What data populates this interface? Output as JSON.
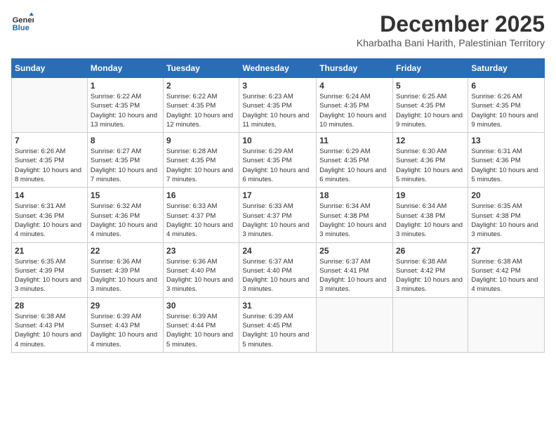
{
  "logo": {
    "line1": "General",
    "line2": "Blue"
  },
  "title": "December 2025",
  "location": "Kharbatha Bani Harith, Palestinian Territory",
  "columns": [
    "Sunday",
    "Monday",
    "Tuesday",
    "Wednesday",
    "Thursday",
    "Friday",
    "Saturday"
  ],
  "weeks": [
    [
      {
        "day": "",
        "sunrise": "",
        "sunset": "",
        "daylight": ""
      },
      {
        "day": "1",
        "sunrise": "Sunrise: 6:22 AM",
        "sunset": "Sunset: 4:35 PM",
        "daylight": "Daylight: 10 hours and 13 minutes."
      },
      {
        "day": "2",
        "sunrise": "Sunrise: 6:22 AM",
        "sunset": "Sunset: 4:35 PM",
        "daylight": "Daylight: 10 hours and 12 minutes."
      },
      {
        "day": "3",
        "sunrise": "Sunrise: 6:23 AM",
        "sunset": "Sunset: 4:35 PM",
        "daylight": "Daylight: 10 hours and 11 minutes."
      },
      {
        "day": "4",
        "sunrise": "Sunrise: 6:24 AM",
        "sunset": "Sunset: 4:35 PM",
        "daylight": "Daylight: 10 hours and 10 minutes."
      },
      {
        "day": "5",
        "sunrise": "Sunrise: 6:25 AM",
        "sunset": "Sunset: 4:35 PM",
        "daylight": "Daylight: 10 hours and 9 minutes."
      },
      {
        "day": "6",
        "sunrise": "Sunrise: 6:26 AM",
        "sunset": "Sunset: 4:35 PM",
        "daylight": "Daylight: 10 hours and 9 minutes."
      }
    ],
    [
      {
        "day": "7",
        "sunrise": "Sunrise: 6:26 AM",
        "sunset": "Sunset: 4:35 PM",
        "daylight": "Daylight: 10 hours and 8 minutes."
      },
      {
        "day": "8",
        "sunrise": "Sunrise: 6:27 AM",
        "sunset": "Sunset: 4:35 PM",
        "daylight": "Daylight: 10 hours and 7 minutes."
      },
      {
        "day": "9",
        "sunrise": "Sunrise: 6:28 AM",
        "sunset": "Sunset: 4:35 PM",
        "daylight": "Daylight: 10 hours and 7 minutes."
      },
      {
        "day": "10",
        "sunrise": "Sunrise: 6:29 AM",
        "sunset": "Sunset: 4:35 PM",
        "daylight": "Daylight: 10 hours and 6 minutes."
      },
      {
        "day": "11",
        "sunrise": "Sunrise: 6:29 AM",
        "sunset": "Sunset: 4:35 PM",
        "daylight": "Daylight: 10 hours and 6 minutes."
      },
      {
        "day": "12",
        "sunrise": "Sunrise: 6:30 AM",
        "sunset": "Sunset: 4:36 PM",
        "daylight": "Daylight: 10 hours and 5 minutes."
      },
      {
        "day": "13",
        "sunrise": "Sunrise: 6:31 AM",
        "sunset": "Sunset: 4:36 PM",
        "daylight": "Daylight: 10 hours and 5 minutes."
      }
    ],
    [
      {
        "day": "14",
        "sunrise": "Sunrise: 6:31 AM",
        "sunset": "Sunset: 4:36 PM",
        "daylight": "Daylight: 10 hours and 4 minutes."
      },
      {
        "day": "15",
        "sunrise": "Sunrise: 6:32 AM",
        "sunset": "Sunset: 4:36 PM",
        "daylight": "Daylight: 10 hours and 4 minutes."
      },
      {
        "day": "16",
        "sunrise": "Sunrise: 6:33 AM",
        "sunset": "Sunset: 4:37 PM",
        "daylight": "Daylight: 10 hours and 4 minutes."
      },
      {
        "day": "17",
        "sunrise": "Sunrise: 6:33 AM",
        "sunset": "Sunset: 4:37 PM",
        "daylight": "Daylight: 10 hours and 3 minutes."
      },
      {
        "day": "18",
        "sunrise": "Sunrise: 6:34 AM",
        "sunset": "Sunset: 4:38 PM",
        "daylight": "Daylight: 10 hours and 3 minutes."
      },
      {
        "day": "19",
        "sunrise": "Sunrise: 6:34 AM",
        "sunset": "Sunset: 4:38 PM",
        "daylight": "Daylight: 10 hours and 3 minutes."
      },
      {
        "day": "20",
        "sunrise": "Sunrise: 6:35 AM",
        "sunset": "Sunset: 4:38 PM",
        "daylight": "Daylight: 10 hours and 3 minutes."
      }
    ],
    [
      {
        "day": "21",
        "sunrise": "Sunrise: 6:35 AM",
        "sunset": "Sunset: 4:39 PM",
        "daylight": "Daylight: 10 hours and 3 minutes."
      },
      {
        "day": "22",
        "sunrise": "Sunrise: 6:36 AM",
        "sunset": "Sunset: 4:39 PM",
        "daylight": "Daylight: 10 hours and 3 minutes."
      },
      {
        "day": "23",
        "sunrise": "Sunrise: 6:36 AM",
        "sunset": "Sunset: 4:40 PM",
        "daylight": "Daylight: 10 hours and 3 minutes."
      },
      {
        "day": "24",
        "sunrise": "Sunrise: 6:37 AM",
        "sunset": "Sunset: 4:40 PM",
        "daylight": "Daylight: 10 hours and 3 minutes."
      },
      {
        "day": "25",
        "sunrise": "Sunrise: 6:37 AM",
        "sunset": "Sunset: 4:41 PM",
        "daylight": "Daylight: 10 hours and 3 minutes."
      },
      {
        "day": "26",
        "sunrise": "Sunrise: 6:38 AM",
        "sunset": "Sunset: 4:42 PM",
        "daylight": "Daylight: 10 hours and 3 minutes."
      },
      {
        "day": "27",
        "sunrise": "Sunrise: 6:38 AM",
        "sunset": "Sunset: 4:42 PM",
        "daylight": "Daylight: 10 hours and 4 minutes."
      }
    ],
    [
      {
        "day": "28",
        "sunrise": "Sunrise: 6:38 AM",
        "sunset": "Sunset: 4:43 PM",
        "daylight": "Daylight: 10 hours and 4 minutes."
      },
      {
        "day": "29",
        "sunrise": "Sunrise: 6:39 AM",
        "sunset": "Sunset: 4:43 PM",
        "daylight": "Daylight: 10 hours and 4 minutes."
      },
      {
        "day": "30",
        "sunrise": "Sunrise: 6:39 AM",
        "sunset": "Sunset: 4:44 PM",
        "daylight": "Daylight: 10 hours and 5 minutes."
      },
      {
        "day": "31",
        "sunrise": "Sunrise: 6:39 AM",
        "sunset": "Sunset: 4:45 PM",
        "daylight": "Daylight: 10 hours and 5 minutes."
      },
      {
        "day": "",
        "sunrise": "",
        "sunset": "",
        "daylight": ""
      },
      {
        "day": "",
        "sunrise": "",
        "sunset": "",
        "daylight": ""
      },
      {
        "day": "",
        "sunrise": "",
        "sunset": "",
        "daylight": ""
      }
    ]
  ]
}
